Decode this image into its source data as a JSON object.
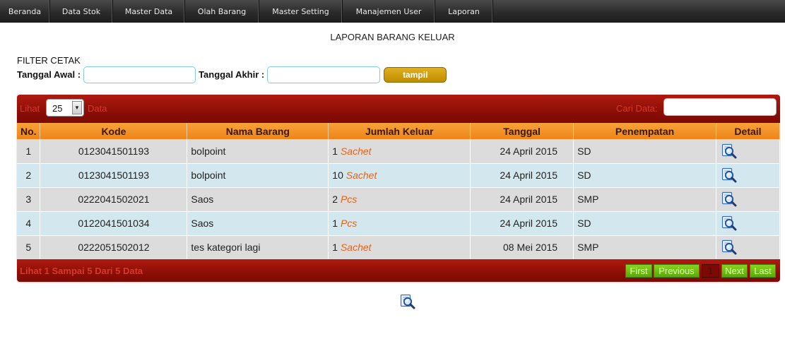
{
  "nav": {
    "items": [
      {
        "label": "Beranda"
      },
      {
        "label": "Data Stok"
      },
      {
        "label": "Master Data"
      },
      {
        "label": "Olah Barang"
      },
      {
        "label": "Master Setting"
      },
      {
        "label": "Manajemen User"
      },
      {
        "label": "Laporan"
      }
    ]
  },
  "page": {
    "title": "LAPORAN BARANG KELUAR"
  },
  "filter": {
    "heading": "FILTER CETAK",
    "start_label": "Tanggal Awal :",
    "end_label": "Tanggal Akhir :",
    "start_value": "",
    "end_value": "",
    "button_label": "tampil"
  },
  "grid": {
    "show_label": "Lihat",
    "page_size": "25",
    "data_label": "Data",
    "search_label": "Cari Data:",
    "search_value": "",
    "columns": [
      "No.",
      "Kode",
      "Nama Barang",
      "Jumlah Keluar",
      "Tanggal",
      "Penempatan",
      "Detail"
    ],
    "rows": [
      {
        "no": "1",
        "kode": "0123041501193",
        "nama": "bolpoint",
        "qty": "1",
        "unit": "Sachet",
        "tanggal": "24 April 2015",
        "penempatan": "SD"
      },
      {
        "no": "2",
        "kode": "0123041501193",
        "nama": "bolpoint",
        "qty": "10",
        "unit": "Sachet",
        "tanggal": "24 April 2015",
        "penempatan": "SD"
      },
      {
        "no": "3",
        "kode": "0222041502021",
        "nama": "Saos",
        "qty": "2",
        "unit": "Pcs",
        "tanggal": "24 April 2015",
        "penempatan": "SMP"
      },
      {
        "no": "4",
        "kode": "0122041501034",
        "nama": "Saos",
        "qty": "1",
        "unit": "Pcs",
        "tanggal": "24 April 2015",
        "penempatan": "SD"
      },
      {
        "no": "5",
        "kode": "0222051502012",
        "nama": "tes kategori lagi",
        "qty": "1",
        "unit": "Sachet",
        "tanggal": "08 Mei 2015",
        "penempatan": "SMP"
      }
    ],
    "info": "Lihat 1 Sampai 5 Dari 5 Data",
    "pagination": {
      "first": "First",
      "previous": "Previous",
      "current": "1",
      "next": "Next",
      "last": "Last"
    }
  },
  "icons": {
    "detail": "magnifier-document-icon",
    "print": "magnifier-document-icon",
    "dropdown": "triangle-down-icon"
  },
  "colors": {
    "nav_bg": "#2c2c2c",
    "bar_red": "#8c0e06",
    "header_orange": "#f08418",
    "row_gray": "#dcdcdc",
    "row_blue": "#d3e7ef",
    "unit_orange": "#e0651c",
    "pager_green": "#5aa80c",
    "button_gold": "#c08d00"
  }
}
